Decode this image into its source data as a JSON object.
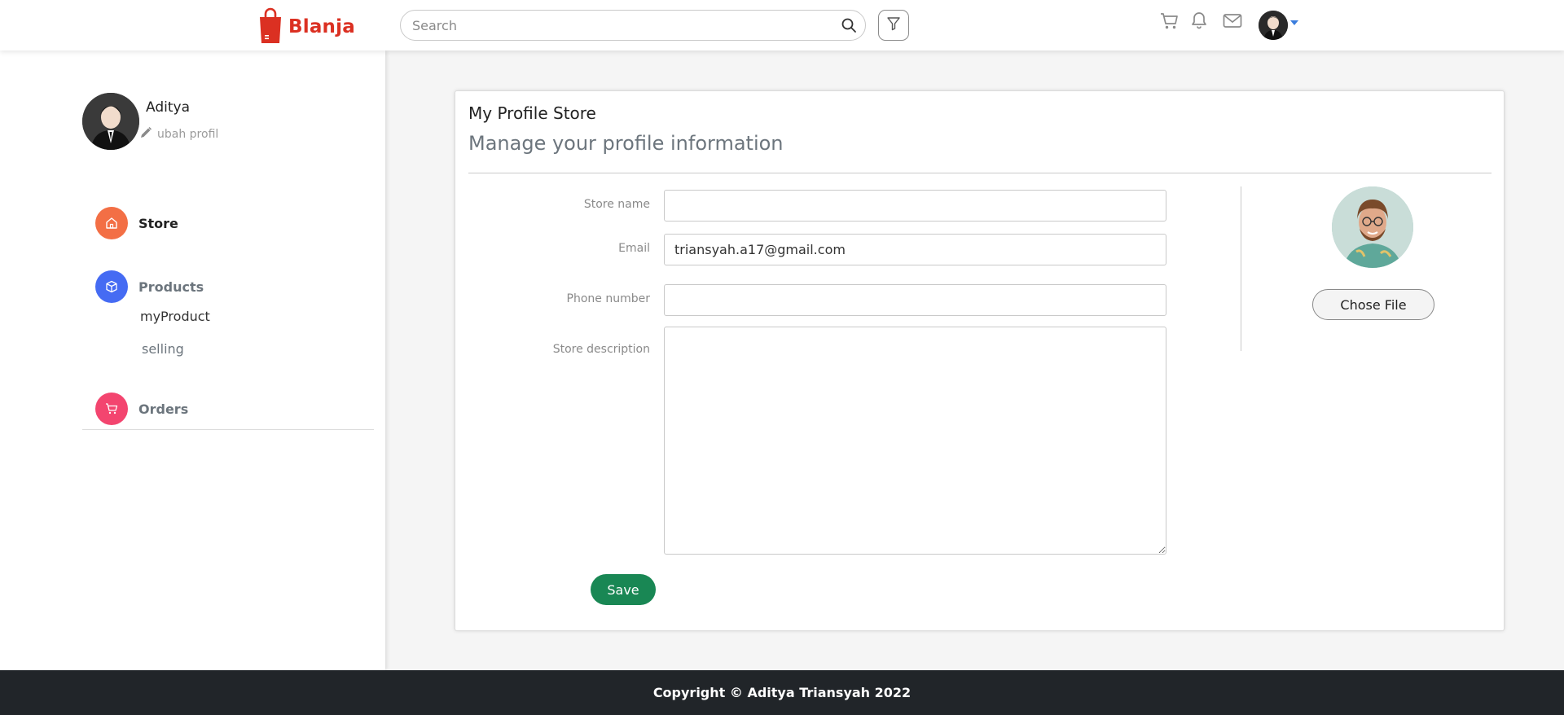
{
  "header": {
    "brand": "Blanja",
    "brand_color": "#db3022",
    "search_placeholder": "Search",
    "icons": [
      "shopping-bag-icon",
      "search-icon",
      "filter-icon",
      "cart-icon",
      "bell-icon",
      "mail-icon",
      "avatar",
      "caret-down-icon"
    ]
  },
  "sidebar": {
    "user_name": "Aditya",
    "edit_label": "ubah profil",
    "nav": {
      "store": {
        "label": "Store",
        "color": "#f36f45",
        "icon": "home-icon"
      },
      "products": {
        "label": "Products",
        "color": "#456bf3",
        "icon": "box-icon"
      },
      "orders": {
        "label": "Orders",
        "color": "#f3456f",
        "icon": "cart-icon"
      }
    },
    "sub_items": [
      "myProduct",
      "selling"
    ]
  },
  "main": {
    "title": "My Profile Store",
    "subtitle": "Manage your profile information",
    "fields": {
      "store_name": {
        "label": "Store name",
        "value": ""
      },
      "email": {
        "label": "Email",
        "value": "triansyah.a17@gmail.com"
      },
      "phone": {
        "label": "Phone number",
        "value": ""
      },
      "description": {
        "label": "Store description",
        "value": ""
      }
    },
    "choose_file_label": "Chose File",
    "save_label": "Save",
    "save_color": "#198754"
  },
  "footer": {
    "text": "Copyright © Aditya Triansyah 2022"
  }
}
